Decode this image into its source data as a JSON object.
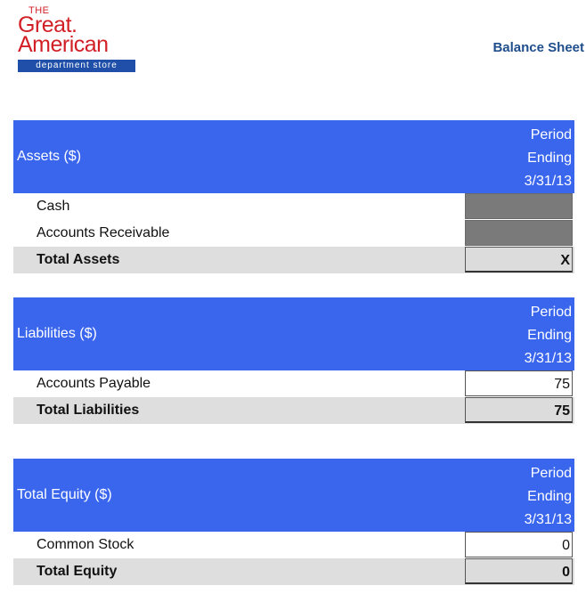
{
  "logo": {
    "the": "THE",
    "great": "Great.",
    "american": "American",
    "tagline": "department store"
  },
  "document_title": "Balance Sheet",
  "period_header": [
    "Period",
    "Ending",
    "3/31/13"
  ],
  "assets": {
    "title": "Assets ($)",
    "rows": [
      {
        "label": "Cash",
        "value": ""
      },
      {
        "label": "Accounts Receivable",
        "value": ""
      }
    ],
    "total": {
      "label": "Total Assets",
      "value": "X"
    }
  },
  "liabilities": {
    "title": "Liabilities ($)",
    "rows": [
      {
        "label": "Accounts Payable",
        "value": "75"
      }
    ],
    "total": {
      "label": "Total Liabilities",
      "value": "75"
    }
  },
  "equity": {
    "title": "Total Equity ($)",
    "rows": [
      {
        "label": "Common Stock",
        "value": "0"
      }
    ],
    "total": {
      "label": "Total Equity",
      "value": "0"
    }
  },
  "colors": {
    "header_blue": "#3a66ee",
    "logo_red": "#d21f26",
    "logo_blue": "#1f4fa8",
    "title_blue": "#1f4e8c",
    "total_row_grey": "#dedede",
    "input_cell_dark": "#7a7a7a"
  }
}
